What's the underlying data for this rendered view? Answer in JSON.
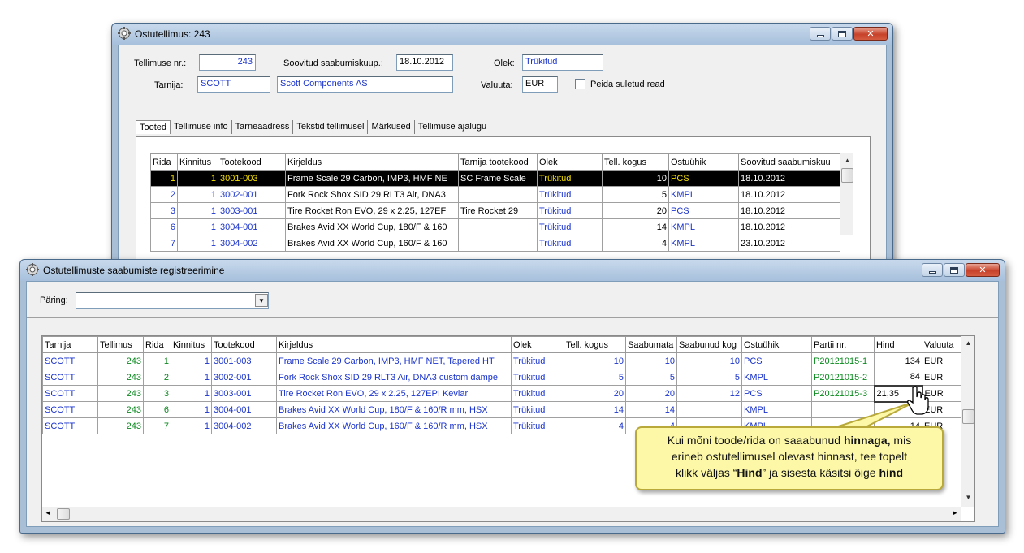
{
  "win1": {
    "title": "Ostutellimus: 243",
    "order_nr_label": "Tellimuse nr.:",
    "order_nr": "243",
    "arrival_label": "Soovitud saabumiskuup.:",
    "arrival": "18.10.2012",
    "status_label": "Olek:",
    "status": "Trükitud",
    "supplier_label": "Tarnija:",
    "supplier_code": "SCOTT",
    "supplier_name": "Scott Components AS",
    "currency_label": "Valuuta:",
    "currency": "EUR",
    "hide_closed_label": "Peida suletud read",
    "tabs": [
      "Tooted",
      "Tellimuse info",
      "Tarneaadress",
      "Tekstid tellimusel",
      "Märkused",
      "Tellimuse ajalugu"
    ],
    "columns": [
      "Rida",
      "Kinnitus",
      "Tootekood",
      "Kirjeldus",
      "Tarnija tootekood",
      "Olek",
      "Tell. kogus",
      "Ostuühik",
      "Soovitud saabumiskuu"
    ],
    "rows": [
      {
        "rida": "1",
        "kinnitus": "1",
        "kood": "3001-003",
        "kirjeldus": "Frame Scale 29 Carbon, IMP3, HMF NE",
        "tarnija_kood": "SC Frame Scale",
        "olek": "Trükitud",
        "kogus": "10",
        "yhik": "PCS",
        "kuup": "18.10.2012"
      },
      {
        "rida": "2",
        "kinnitus": "1",
        "kood": "3002-001",
        "kirjeldus": "Fork Rock Shox SID 29 RLT3 Air, DNA3",
        "tarnija_kood": "",
        "olek": "Trükitud",
        "kogus": "5",
        "yhik": "KMPL",
        "kuup": "18.10.2012"
      },
      {
        "rida": "3",
        "kinnitus": "1",
        "kood": "3003-001",
        "kirjeldus": "Tire Rocket Ron EVO, 29 x 2.25, 127EF",
        "tarnija_kood": "Tire Rocket 29",
        "olek": "Trükitud",
        "kogus": "20",
        "yhik": "PCS",
        "kuup": "18.10.2012"
      },
      {
        "rida": "6",
        "kinnitus": "1",
        "kood": "3004-001",
        "kirjeldus": "Brakes Avid XX World Cup, 180/F & 160",
        "tarnija_kood": "",
        "olek": "Trükitud",
        "kogus": "14",
        "yhik": "KMPL",
        "kuup": "18.10.2012"
      },
      {
        "rida": "7",
        "kinnitus": "1",
        "kood": "3004-002",
        "kirjeldus": "Brakes Avid XX World Cup, 160/F & 160",
        "tarnija_kood": "",
        "olek": "Trükitud",
        "kogus": "4",
        "yhik": "KMPL",
        "kuup": "23.10.2012"
      }
    ]
  },
  "win2": {
    "title": "Ostutellimuste saabumiste registreerimine",
    "query_label": "Päring:",
    "query_value": "",
    "columns": [
      "Tarnija",
      "Tellimus",
      "Rida",
      "Kinnitus",
      "Tootekood",
      "Kirjeldus",
      "Olek",
      "Tell. kogus",
      "Saabumata",
      "Saabunud kog",
      "Ostuühik",
      "Partii nr.",
      "Hind",
      "Valuuta"
    ],
    "rows": [
      {
        "tarnija": "SCOTT",
        "tellimus": "243",
        "rida": "1",
        "kinnitus": "1",
        "kood": "3001-003",
        "kirjeldus": "Frame Scale 29 Carbon, IMP3, HMF NET, Tapered HT",
        "olek": "Trükitud",
        "kogus": "10",
        "saabumata": "10",
        "saabunud": "10",
        "yhik": "PCS",
        "partii": "P20121015-1",
        "hind": "134",
        "valuuta": "EUR"
      },
      {
        "tarnija": "SCOTT",
        "tellimus": "243",
        "rida": "2",
        "kinnitus": "1",
        "kood": "3002-001",
        "kirjeldus": "Fork Rock Shox SID 29 RLT3 Air, DNA3 custom dampe",
        "olek": "Trükitud",
        "kogus": "5",
        "saabumata": "5",
        "saabunud": "5",
        "yhik": "KMPL",
        "partii": "P20121015-2",
        "hind": "84",
        "valuuta": "EUR"
      },
      {
        "tarnija": "SCOTT",
        "tellimus": "243",
        "rida": "3",
        "kinnitus": "1",
        "kood": "3003-001",
        "kirjeldus": "Tire Rocket Ron EVO, 29 x 2.25, 127EPI Kevlar",
        "olek": "Trükitud",
        "kogus": "20",
        "saabumata": "20",
        "saabunud": "12",
        "yhik": "PCS",
        "partii": "P20121015-3",
        "hind": "21,35",
        "valuuta": "EUR"
      },
      {
        "tarnija": "SCOTT",
        "tellimus": "243",
        "rida": "6",
        "kinnitus": "1",
        "kood": "3004-001",
        "kirjeldus": "Brakes Avid XX World Cup, 180/F & 160/R mm, HSX",
        "olek": "Trükitud",
        "kogus": "14",
        "saabumata": "14",
        "saabunud": "",
        "yhik": "KMPL",
        "partii": "",
        "hind": "1",
        "valuuta": "EUR"
      },
      {
        "tarnija": "SCOTT",
        "tellimus": "243",
        "rida": "7",
        "kinnitus": "1",
        "kood": "3004-002",
        "kirjeldus": "Brakes Avid XX World Cup, 160/F & 160/R mm, HSX",
        "olek": "Trükitud",
        "kogus": "4",
        "saabumata": "4",
        "saabunud": "",
        "yhik": "KMPL",
        "partii": "",
        "hind": "14",
        "valuuta": "EUR"
      }
    ]
  },
  "callout": {
    "line1_a": "Kui mõni toode/rida on saaabunud ",
    "line1_b": "hinnaga,",
    "line1_c": " mis",
    "line2": "erineb ostutellimusel olevast hinnast, tee topelt",
    "line3_a": "klikk väljas  “",
    "line3_b": "Hind",
    "line3_c": "” ja sisesta käsitsi õige ",
    "line3_d": "hind"
  },
  "colors": {
    "link_blue": "#1a33cc",
    "green": "#0a8a1e",
    "highlight_yellow": "#f6e000",
    "callout_bg": "#fcf8a8"
  }
}
